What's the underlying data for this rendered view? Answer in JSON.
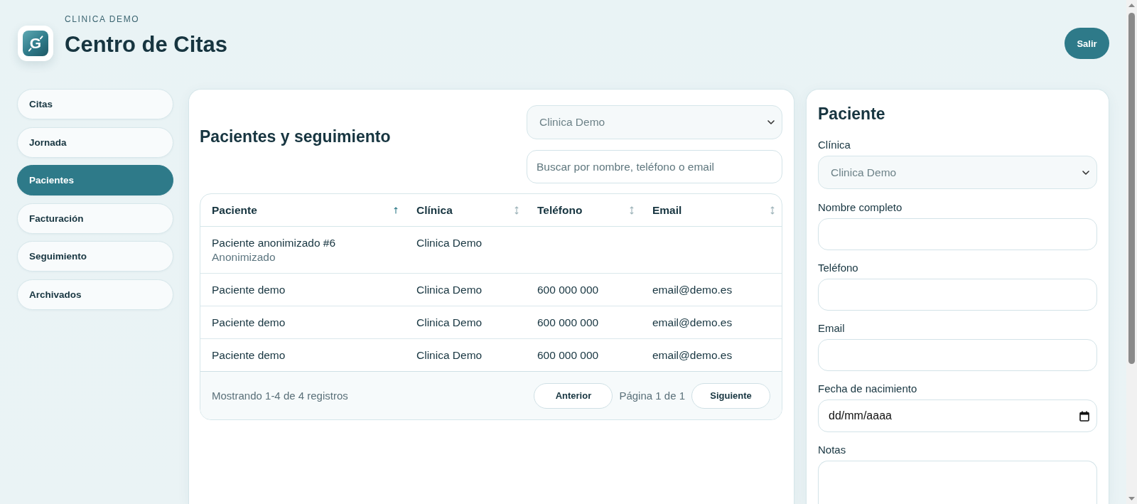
{
  "header": {
    "org": "CLINICA DEMO",
    "title": "Centro de Citas",
    "logo_letter": "G",
    "logout": "Salir"
  },
  "sidebar": {
    "items": [
      {
        "label": "Citas",
        "selected": false
      },
      {
        "label": "Jornada",
        "selected": false
      },
      {
        "label": "Pacientes",
        "selected": true
      },
      {
        "label": "Facturación",
        "selected": false
      },
      {
        "label": "Seguimiento",
        "selected": false
      },
      {
        "label": "Archivados",
        "selected": false
      }
    ]
  },
  "patients_panel": {
    "title": "Pacientes y seguimiento",
    "clinic_select": {
      "value": "Clinica Demo",
      "disabled": true
    },
    "search": {
      "placeholder": "Buscar por nombre, teléfono o email"
    },
    "table": {
      "columns": [
        {
          "label": "Paciente",
          "sorted": true
        },
        {
          "label": "Clínica",
          "sorted": false
        },
        {
          "label": "Teléfono",
          "sorted": false
        },
        {
          "label": "Email",
          "sorted": false
        }
      ],
      "rows": [
        {
          "patient": "Paciente anonimizado #6",
          "note": "Anonimizado",
          "clinic": "Clinica Demo"
        },
        {
          "patient": "Paciente demo",
          "clinic": "Clinica Demo",
          "phone": "600 000 000",
          "email": "email@demo.es"
        },
        {
          "patient": "Paciente demo",
          "clinic": "Clinica Demo",
          "phone": "600 000 000",
          "email": "email@demo.es"
        },
        {
          "patient": "Paciente demo",
          "clinic": "Clinica Demo",
          "phone": "600 000 000",
          "email": "email@demo.es"
        }
      ]
    },
    "footer": {
      "summary": "Mostrando 1-4 de 4 registros",
      "prev": "Anterior",
      "page": "Página 1 de 1",
      "next": "Siguiente"
    }
  },
  "patient_form": {
    "title": "Paciente",
    "fields": [
      {
        "kind": "select",
        "label": "Clínica",
        "value": "Clinica Demo",
        "disabled": true
      },
      {
        "kind": "text",
        "label": "Nombre completo"
      },
      {
        "kind": "text",
        "label": "Teléfono"
      },
      {
        "kind": "text",
        "label": "Email"
      },
      {
        "kind": "date",
        "label": "Fecha de nacimiento",
        "placeholder": "dd/mm/aaaa"
      },
      {
        "kind": "textarea",
        "label": "Notas"
      }
    ]
  }
}
